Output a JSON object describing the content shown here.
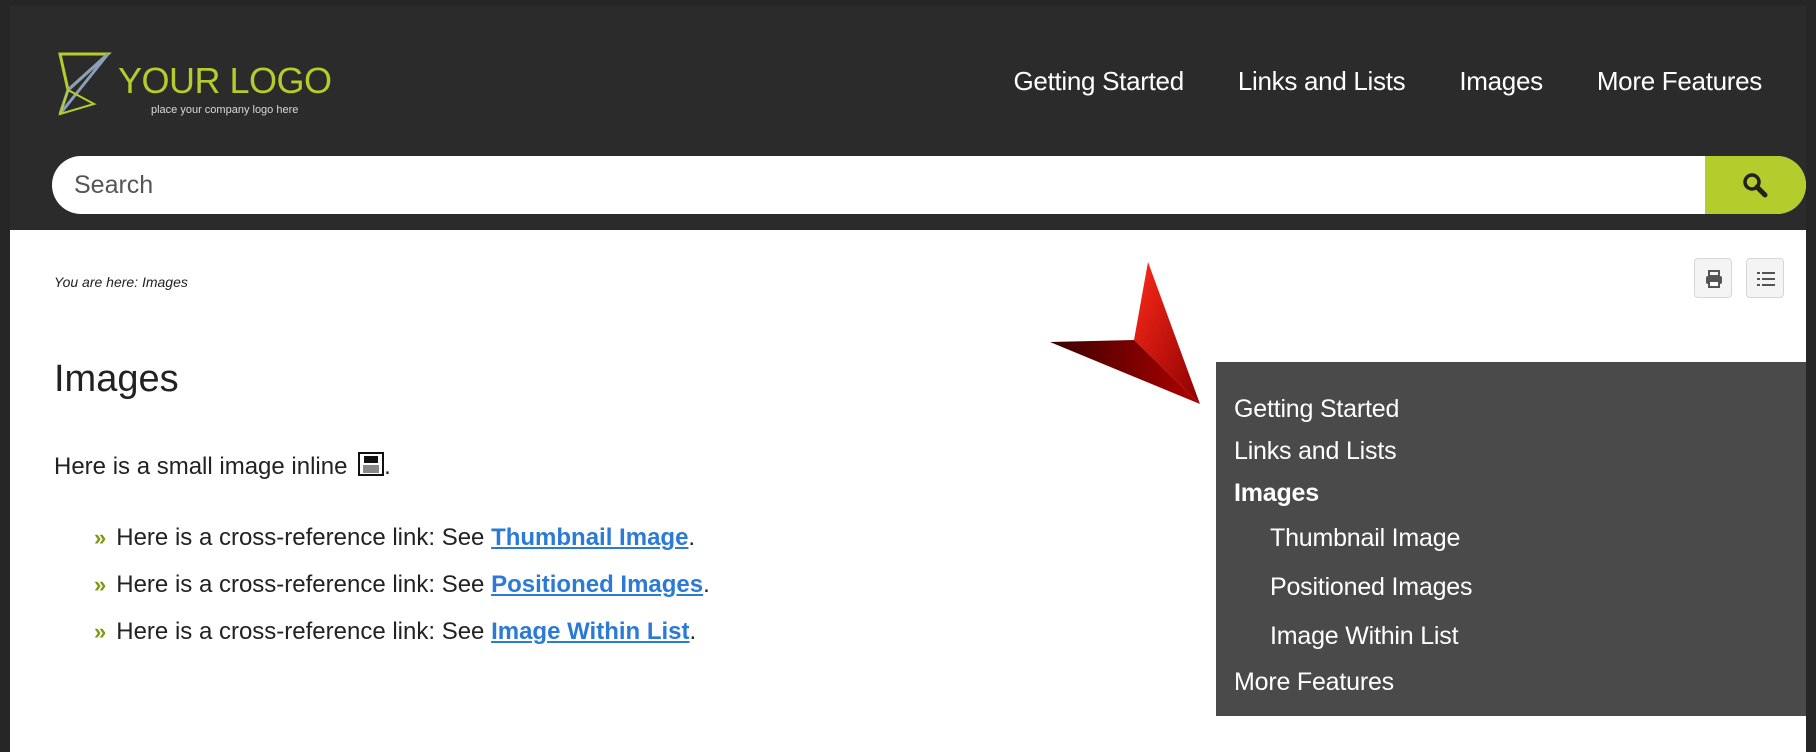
{
  "header": {
    "logo_title": "YOUR LOGO",
    "logo_tagline": "place your company logo here",
    "nav": [
      "Getting Started",
      "Links and Lists",
      "Images",
      "More Features"
    ],
    "search_placeholder": "Search"
  },
  "breadcrumb": "You are here: Images",
  "page": {
    "title": "Images",
    "intro": "Here is a small image inline",
    "intro_end": ".",
    "xrefs": [
      {
        "prefix": "Here is a cross-reference link: See ",
        "link": "Thumbnail Image",
        "suffix": "."
      },
      {
        "prefix": "Here is a cross-reference link: See ",
        "link": "Positioned Images",
        "suffix": "."
      },
      {
        "prefix": "Here is a cross-reference link: See ",
        "link": "Image Within List",
        "suffix": "."
      }
    ]
  },
  "side_menu": {
    "items": [
      "Getting Started",
      "Links and Lists",
      "Images"
    ],
    "sub_items": [
      "Thumbnail Image",
      "Positioned Images",
      "Image Within List"
    ],
    "last_item": "More Features"
  },
  "colors": {
    "accent": "#b4cc2c",
    "header_bg": "#2b2b2b",
    "menu_bg": "#4a4a4a",
    "link": "#2b7bd6",
    "bullet": "#7c9a12"
  },
  "icons": [
    "logo-mark-icon",
    "search-icon",
    "print-icon",
    "toc-icon",
    "save-disk-icon",
    "red-arrow-icon"
  ]
}
